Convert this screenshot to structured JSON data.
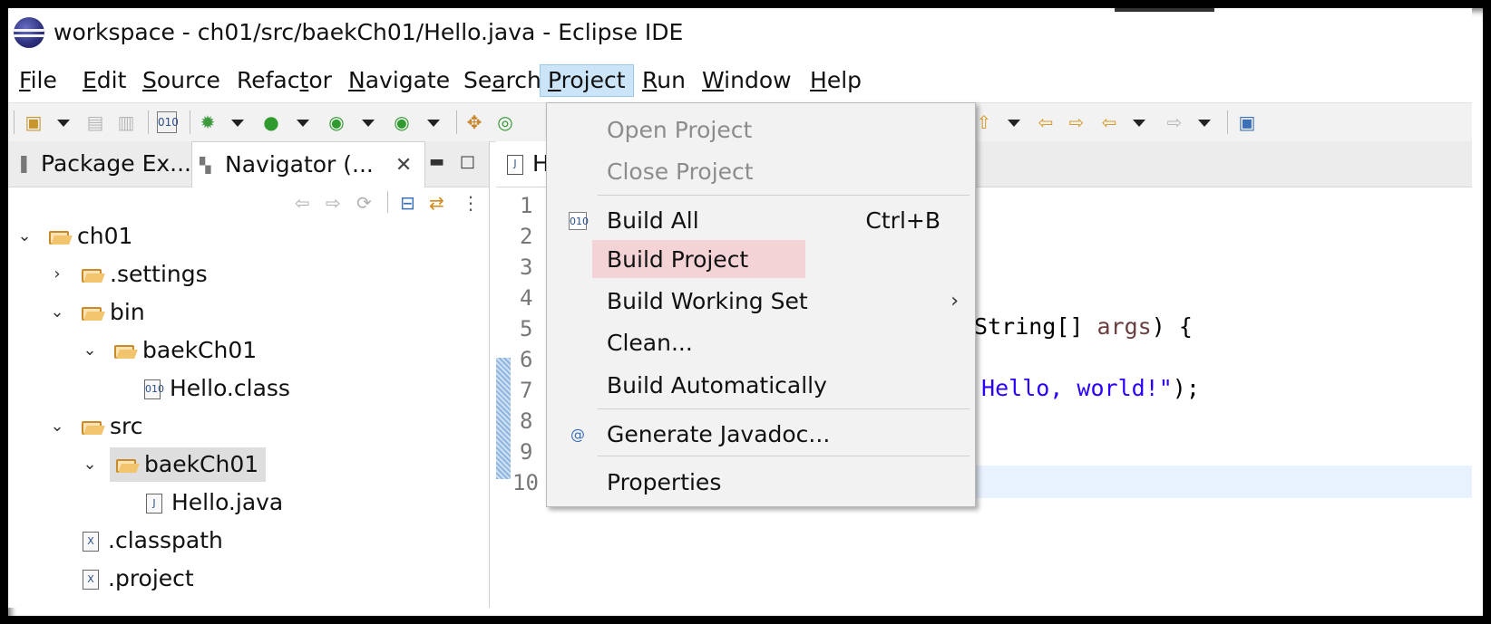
{
  "window": {
    "title": "workspace - ch01/src/baekCh01/Hello.java - Eclipse IDE"
  },
  "menubar": {
    "items": [
      {
        "label": "File",
        "mnemonic": "F",
        "rest": "ile"
      },
      {
        "label": "Edit",
        "mnemonic": "E",
        "rest": "dit"
      },
      {
        "label": "Source",
        "mnemonic": "S",
        "rest": "ource"
      },
      {
        "label": "Refactor",
        "pre": "Refac",
        "mnemonic": "t",
        "rest": "or"
      },
      {
        "label": "Navigate",
        "mnemonic": "N",
        "rest": "avigate"
      },
      {
        "label": "Search",
        "pre": "Se",
        "mnemonic": "a",
        "rest": "rch"
      },
      {
        "label": "Project",
        "mnemonic": "P",
        "rest": "roject"
      },
      {
        "label": "Run",
        "mnemonic": "R",
        "rest": "un"
      },
      {
        "label": "Window",
        "mnemonic": "W",
        "rest": "indow"
      },
      {
        "label": "Help",
        "mnemonic": "H",
        "rest": "elp"
      }
    ]
  },
  "left_panel": {
    "tabs": [
      {
        "label": "Package Ex..."
      },
      {
        "label": "Navigator (..."
      }
    ],
    "tree": [
      {
        "label": "ch01",
        "kind": "project",
        "expanded": true
      },
      {
        "label": ".settings",
        "kind": "folder",
        "expanded": false
      },
      {
        "label": "bin",
        "kind": "folder",
        "expanded": true
      },
      {
        "label": "baekCh01",
        "kind": "folder",
        "expanded": true
      },
      {
        "label": "Hello.class",
        "kind": "class-file"
      },
      {
        "label": "src",
        "kind": "folder",
        "expanded": true
      },
      {
        "label": "baekCh01",
        "kind": "folder",
        "expanded": true,
        "selected": true
      },
      {
        "label": "Hello.java",
        "kind": "java-file"
      },
      {
        "label": ".classpath",
        "kind": "xml-file"
      },
      {
        "label": ".project",
        "kind": "xml-file"
      }
    ]
  },
  "editor": {
    "tab": {
      "label": "H"
    },
    "line_numbers": [
      "1",
      "2",
      "3",
      "4",
      "5",
      "6",
      "7",
      "8",
      "9",
      "10"
    ],
    "code_line5": {
      "plain1": "(String[] ",
      "var": "args",
      "plain2": ") {"
    },
    "code_line7": {
      "str": "'Hello, world!\"",
      "plain": ");"
    }
  },
  "project_menu": {
    "items": [
      {
        "label": "Open Project",
        "enabled": false
      },
      {
        "label": "Close Project",
        "enabled": false
      },
      {
        "label": "Build All",
        "shortcut": "Ctrl+B",
        "icon": "build-all-icon"
      },
      {
        "label": "Build Project",
        "highlighted": true
      },
      {
        "label": "Build Working Set",
        "submenu": true
      },
      {
        "label": "Clean..."
      },
      {
        "label": "Build Automatically"
      },
      {
        "label": "Generate Javadoc...",
        "icon": "javadoc-icon"
      },
      {
        "label": "Properties"
      }
    ],
    "submenu_arrow": "›",
    "binary_icon_text": "010"
  },
  "colors": {
    "menu_active_bg": "#cce4f7",
    "menu_highlight_bg": "#f3d3d6",
    "string_literal": "#2a00ff"
  }
}
